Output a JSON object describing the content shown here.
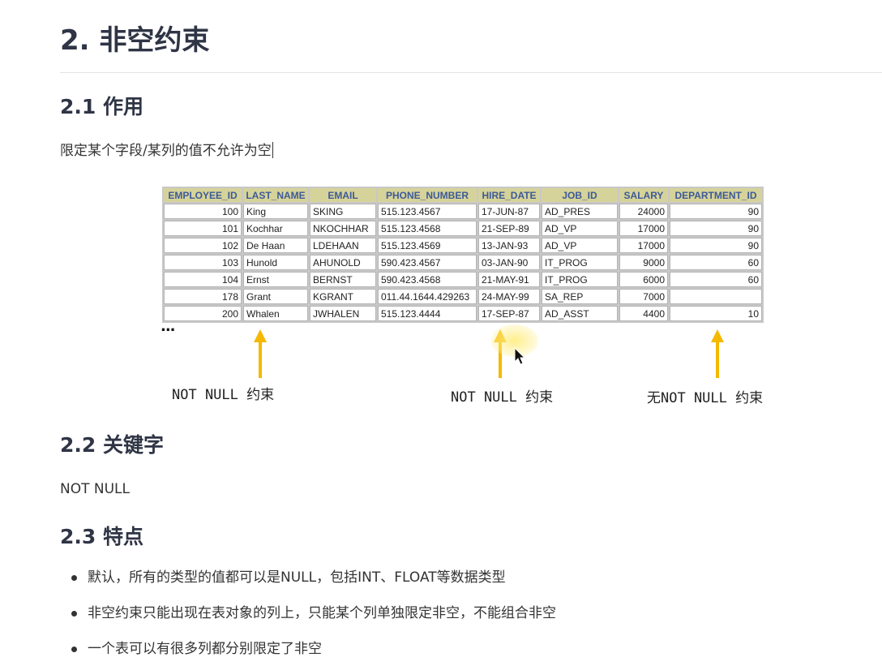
{
  "heading_main": "2. 非空约束",
  "section_1": {
    "heading": "2.1 作用",
    "text": "限定某个字段/某列的值不允许为空"
  },
  "figure": {
    "columns": [
      "EMPLOYEE_ID",
      "LAST_NAME",
      "EMAIL",
      "PHONE_NUMBER",
      "HIRE_DATE",
      "JOB_ID",
      "SALARY",
      "DEPARTMENT_ID"
    ],
    "rows": [
      [
        "100",
        "King",
        "SKING",
        "515.123.4567",
        "17-JUN-87",
        "AD_PRES",
        "24000",
        "90"
      ],
      [
        "101",
        "Kochhar",
        "NKOCHHAR",
        "515.123.4568",
        "21-SEP-89",
        "AD_VP",
        "17000",
        "90"
      ],
      [
        "102",
        "De Haan",
        "LDEHAAN",
        "515.123.4569",
        "13-JAN-93",
        "AD_VP",
        "17000",
        "90"
      ],
      [
        "103",
        "Hunold",
        "AHUNOLD",
        "590.423.4567",
        "03-JAN-90",
        "IT_PROG",
        "9000",
        "60"
      ],
      [
        "104",
        "Ernst",
        "BERNST",
        "590.423.4568",
        "21-MAY-91",
        "IT_PROG",
        "6000",
        "60"
      ],
      [
        "178",
        "Grant",
        "KGRANT",
        "011.44.1644.429263",
        "24-MAY-99",
        "SA_REP",
        "7000",
        ""
      ],
      [
        "200",
        "Whalen",
        "JWHALEN",
        "515.123.4444",
        "17-SEP-87",
        "AD_ASST",
        "4400",
        "10"
      ]
    ],
    "ellipsis": "...",
    "caption_left": "NOT NULL 约束",
    "caption_middle": "NOT NULL 约束",
    "caption_right": "无NOT NULL 约束",
    "arrow_color": "#f5b800",
    "header_bg": "#d6d39a",
    "header_text": "#3d5a98"
  },
  "section_2": {
    "heading": "2.2 关键字",
    "text": "NOT NULL"
  },
  "section_3": {
    "heading": "2.3 特点",
    "items": [
      "默认，所有的类型的值都可以是NULL，包括INT、FLOAT等数据类型",
      "非空约束只能出现在表对象的列上，只能某个列单独限定非空，不能组合非空",
      "一个表可以有很多列都分别限定了非空"
    ]
  }
}
